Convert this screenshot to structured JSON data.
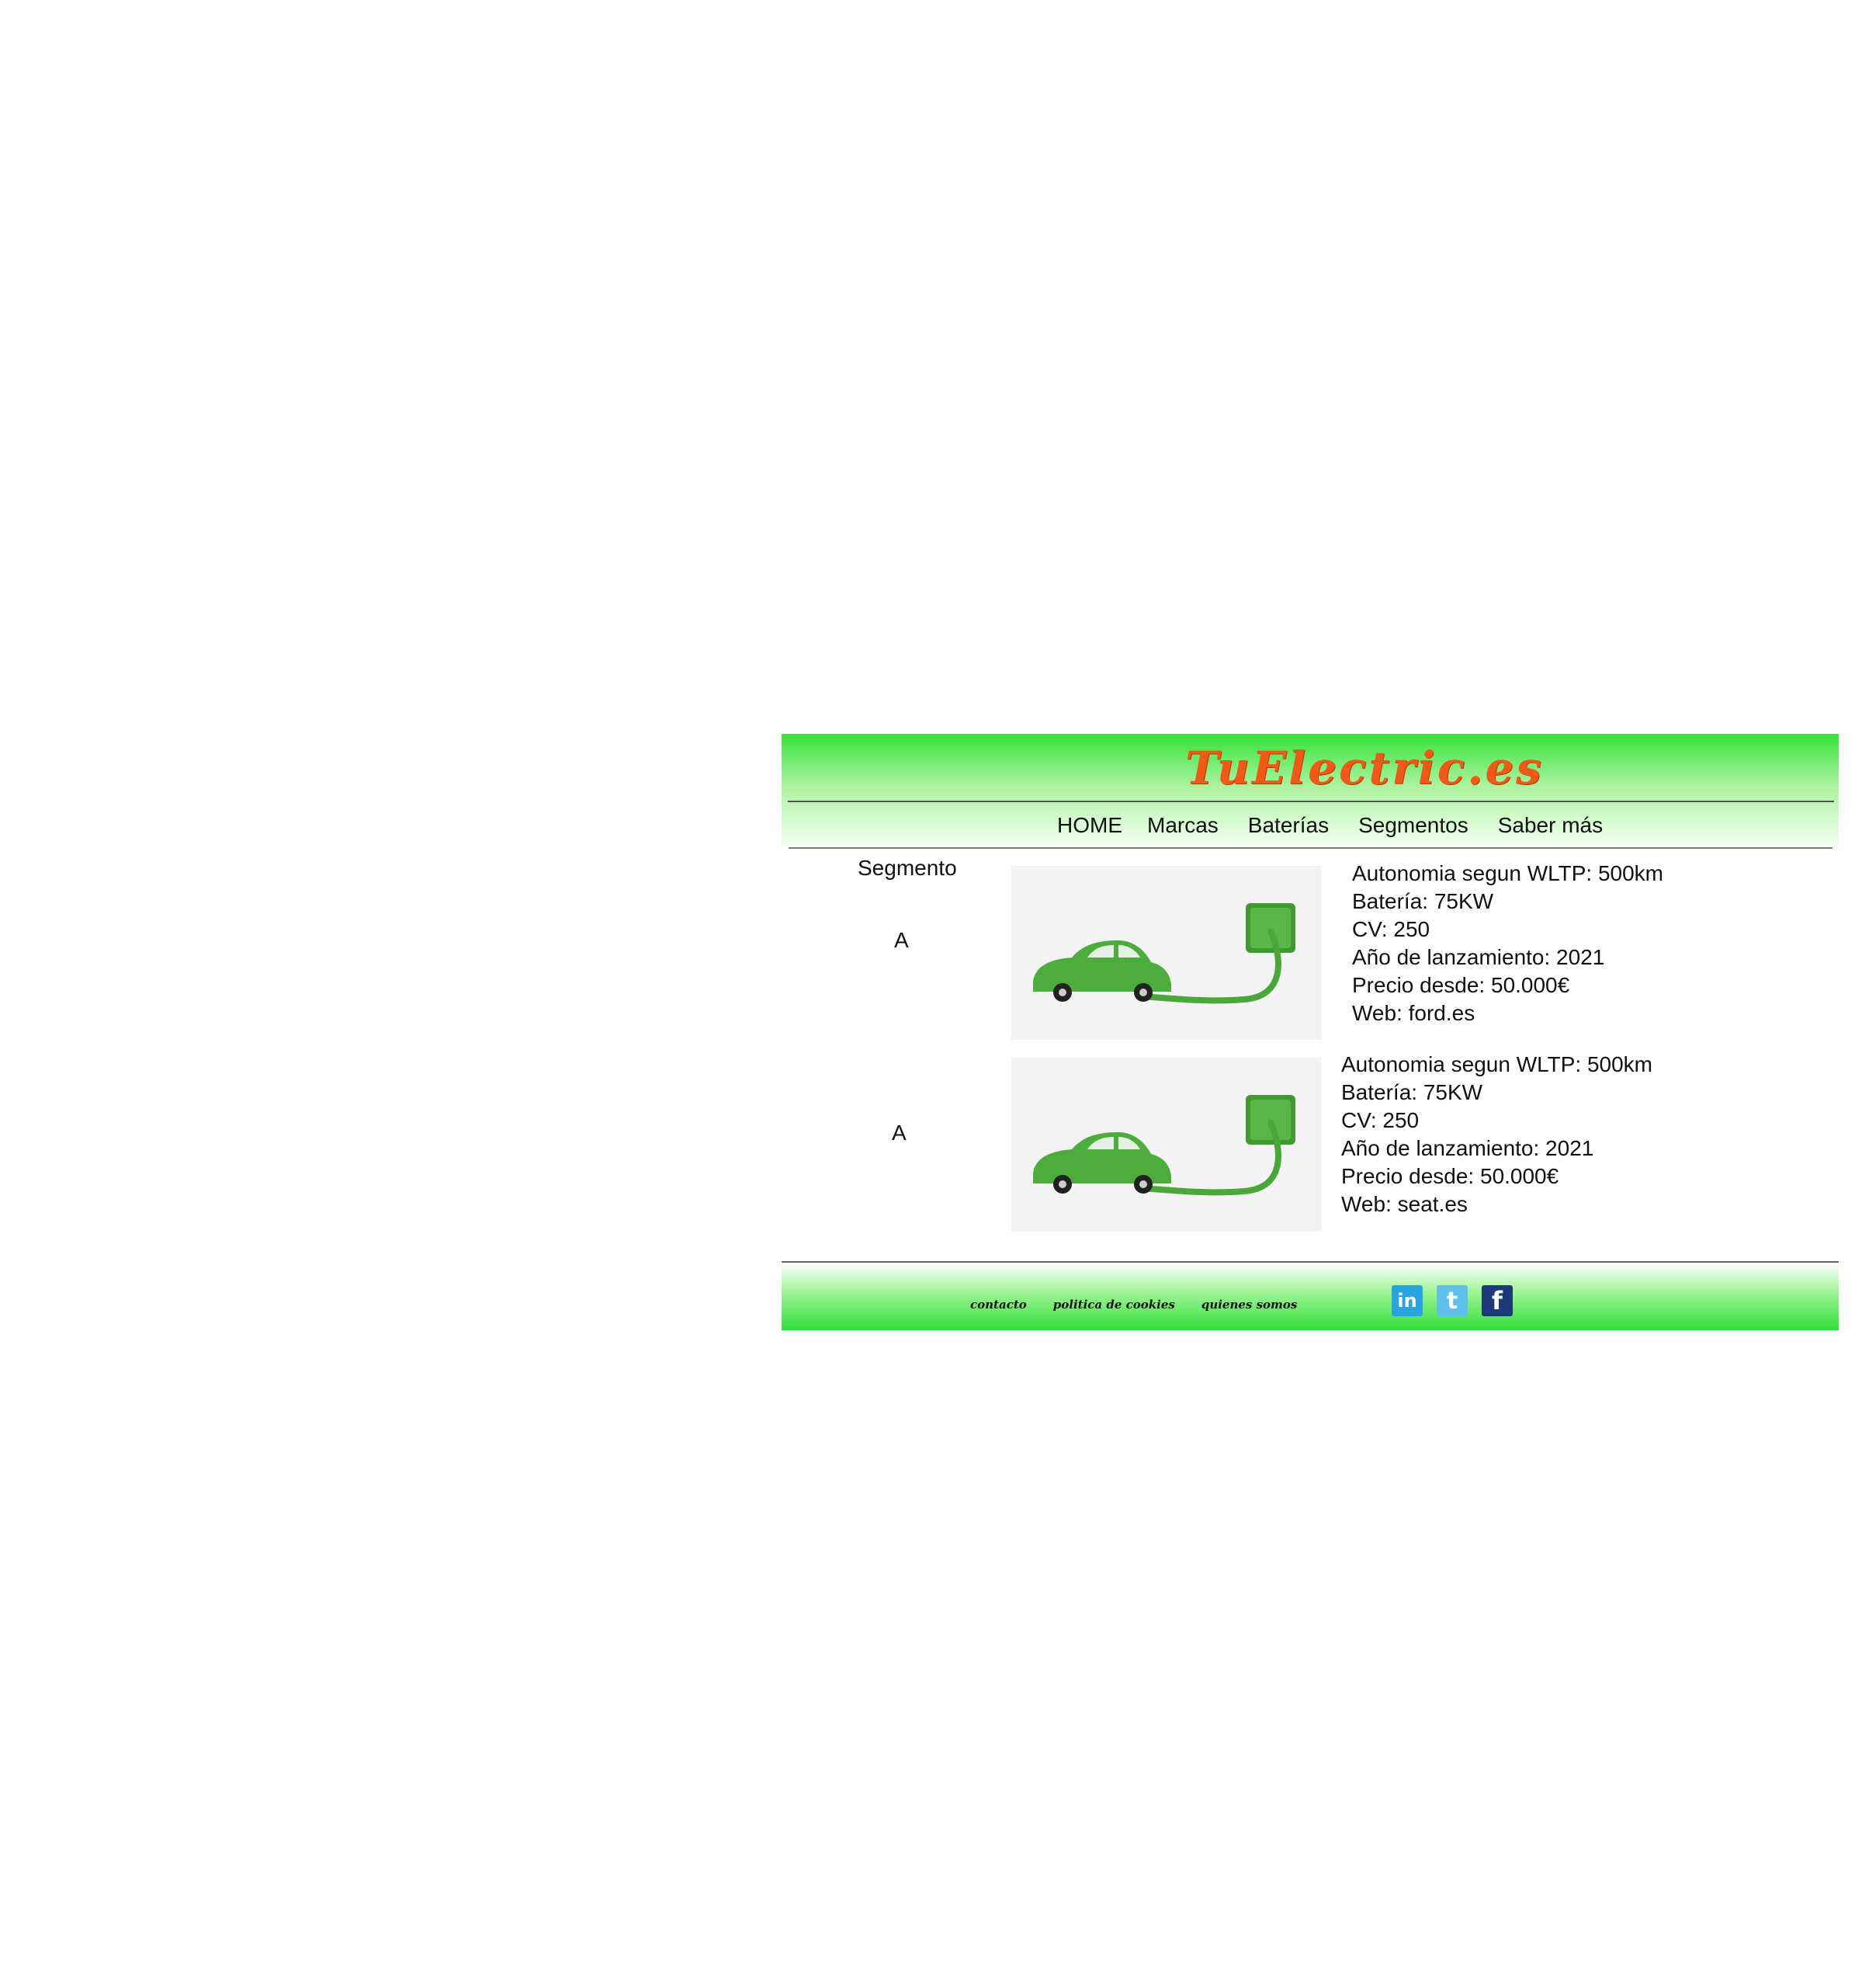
{
  "header": {
    "logo": "TuElectric.es",
    "nav": [
      "HOME",
      "Marcas",
      "Baterías",
      "Segmentos",
      "Saber más"
    ]
  },
  "segment": {
    "title": "Segmento",
    "rows": [
      {
        "letter": "A",
        "specs": [
          "Autonomia segun WLTP: 500km",
          "Batería: 75KW",
          "CV: 250",
          "Año de lanzamiento: 2021",
          "Precio desde: 50.000€",
          "Web: ford.es"
        ]
      },
      {
        "letter": "A",
        "specs": [
          "Autonomia segun WLTP: 500km",
          "Batería: 75KW",
          "CV: 250",
          "Año de lanzamiento: 2021",
          "Precio desde: 50.000€",
          "Web: seat.es"
        ]
      }
    ]
  },
  "footer": {
    "links": [
      "contacto",
      "politica de cookies",
      "quienes somos"
    ],
    "social": [
      {
        "icon": "linkedin-icon",
        "glyph": "in",
        "color": "#2aa4e0"
      },
      {
        "icon": "twitter-icon",
        "glyph": "t",
        "color": "#5fc0ea"
      },
      {
        "icon": "facebook-icon",
        "glyph": "f",
        "color": "#1d3a78"
      }
    ]
  },
  "colors": {
    "brand_green": "#34e23a",
    "logo_orange": "#f05a17"
  }
}
